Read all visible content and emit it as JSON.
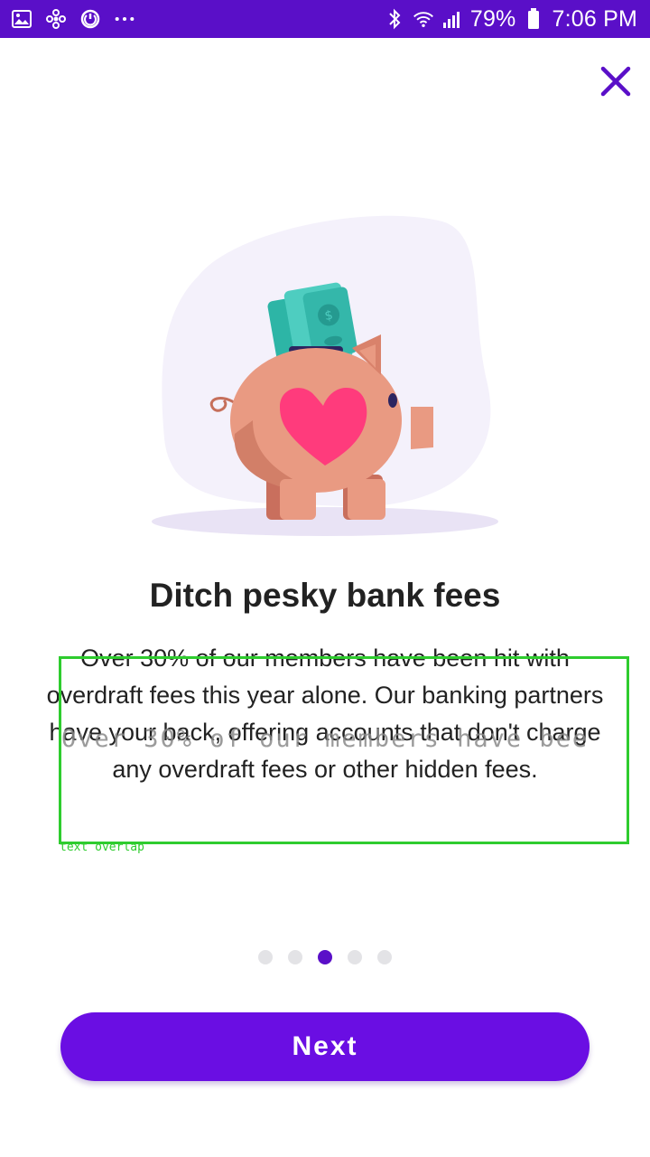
{
  "status_bar": {
    "battery_percent": "79%",
    "time": "7:06 PM",
    "left_icons": [
      "gallery-icon",
      "fan-icon",
      "sync-icon",
      "more-dots-icon"
    ],
    "right_icons": [
      "bluetooth-icon",
      "wifi-icon",
      "signal-icon",
      "battery-icon"
    ],
    "background_color": "#5a0fc8"
  },
  "header": {
    "close_icon": "close-icon"
  },
  "illustration": {
    "subject": "piggy-bank-with-cash-icon"
  },
  "content": {
    "title": "Ditch pesky bank fees",
    "body": "Over 30% of our members have been hit with overdraft fees this year alone. Our banking partners have your back, offering accounts that don't charge any overdraft fees or other hidden fees.",
    "overlay_text": "Over 30% of our members have bee",
    "debug_label": "text overlap"
  },
  "pager": {
    "total": 5,
    "current": 3
  },
  "footer": {
    "next_label": "Next"
  },
  "colors": {
    "primary": "#6a0ee3",
    "dot_active": "#5a0fc8",
    "dot_inactive": "#e3e3e6",
    "debug": "#2ecc2e"
  }
}
